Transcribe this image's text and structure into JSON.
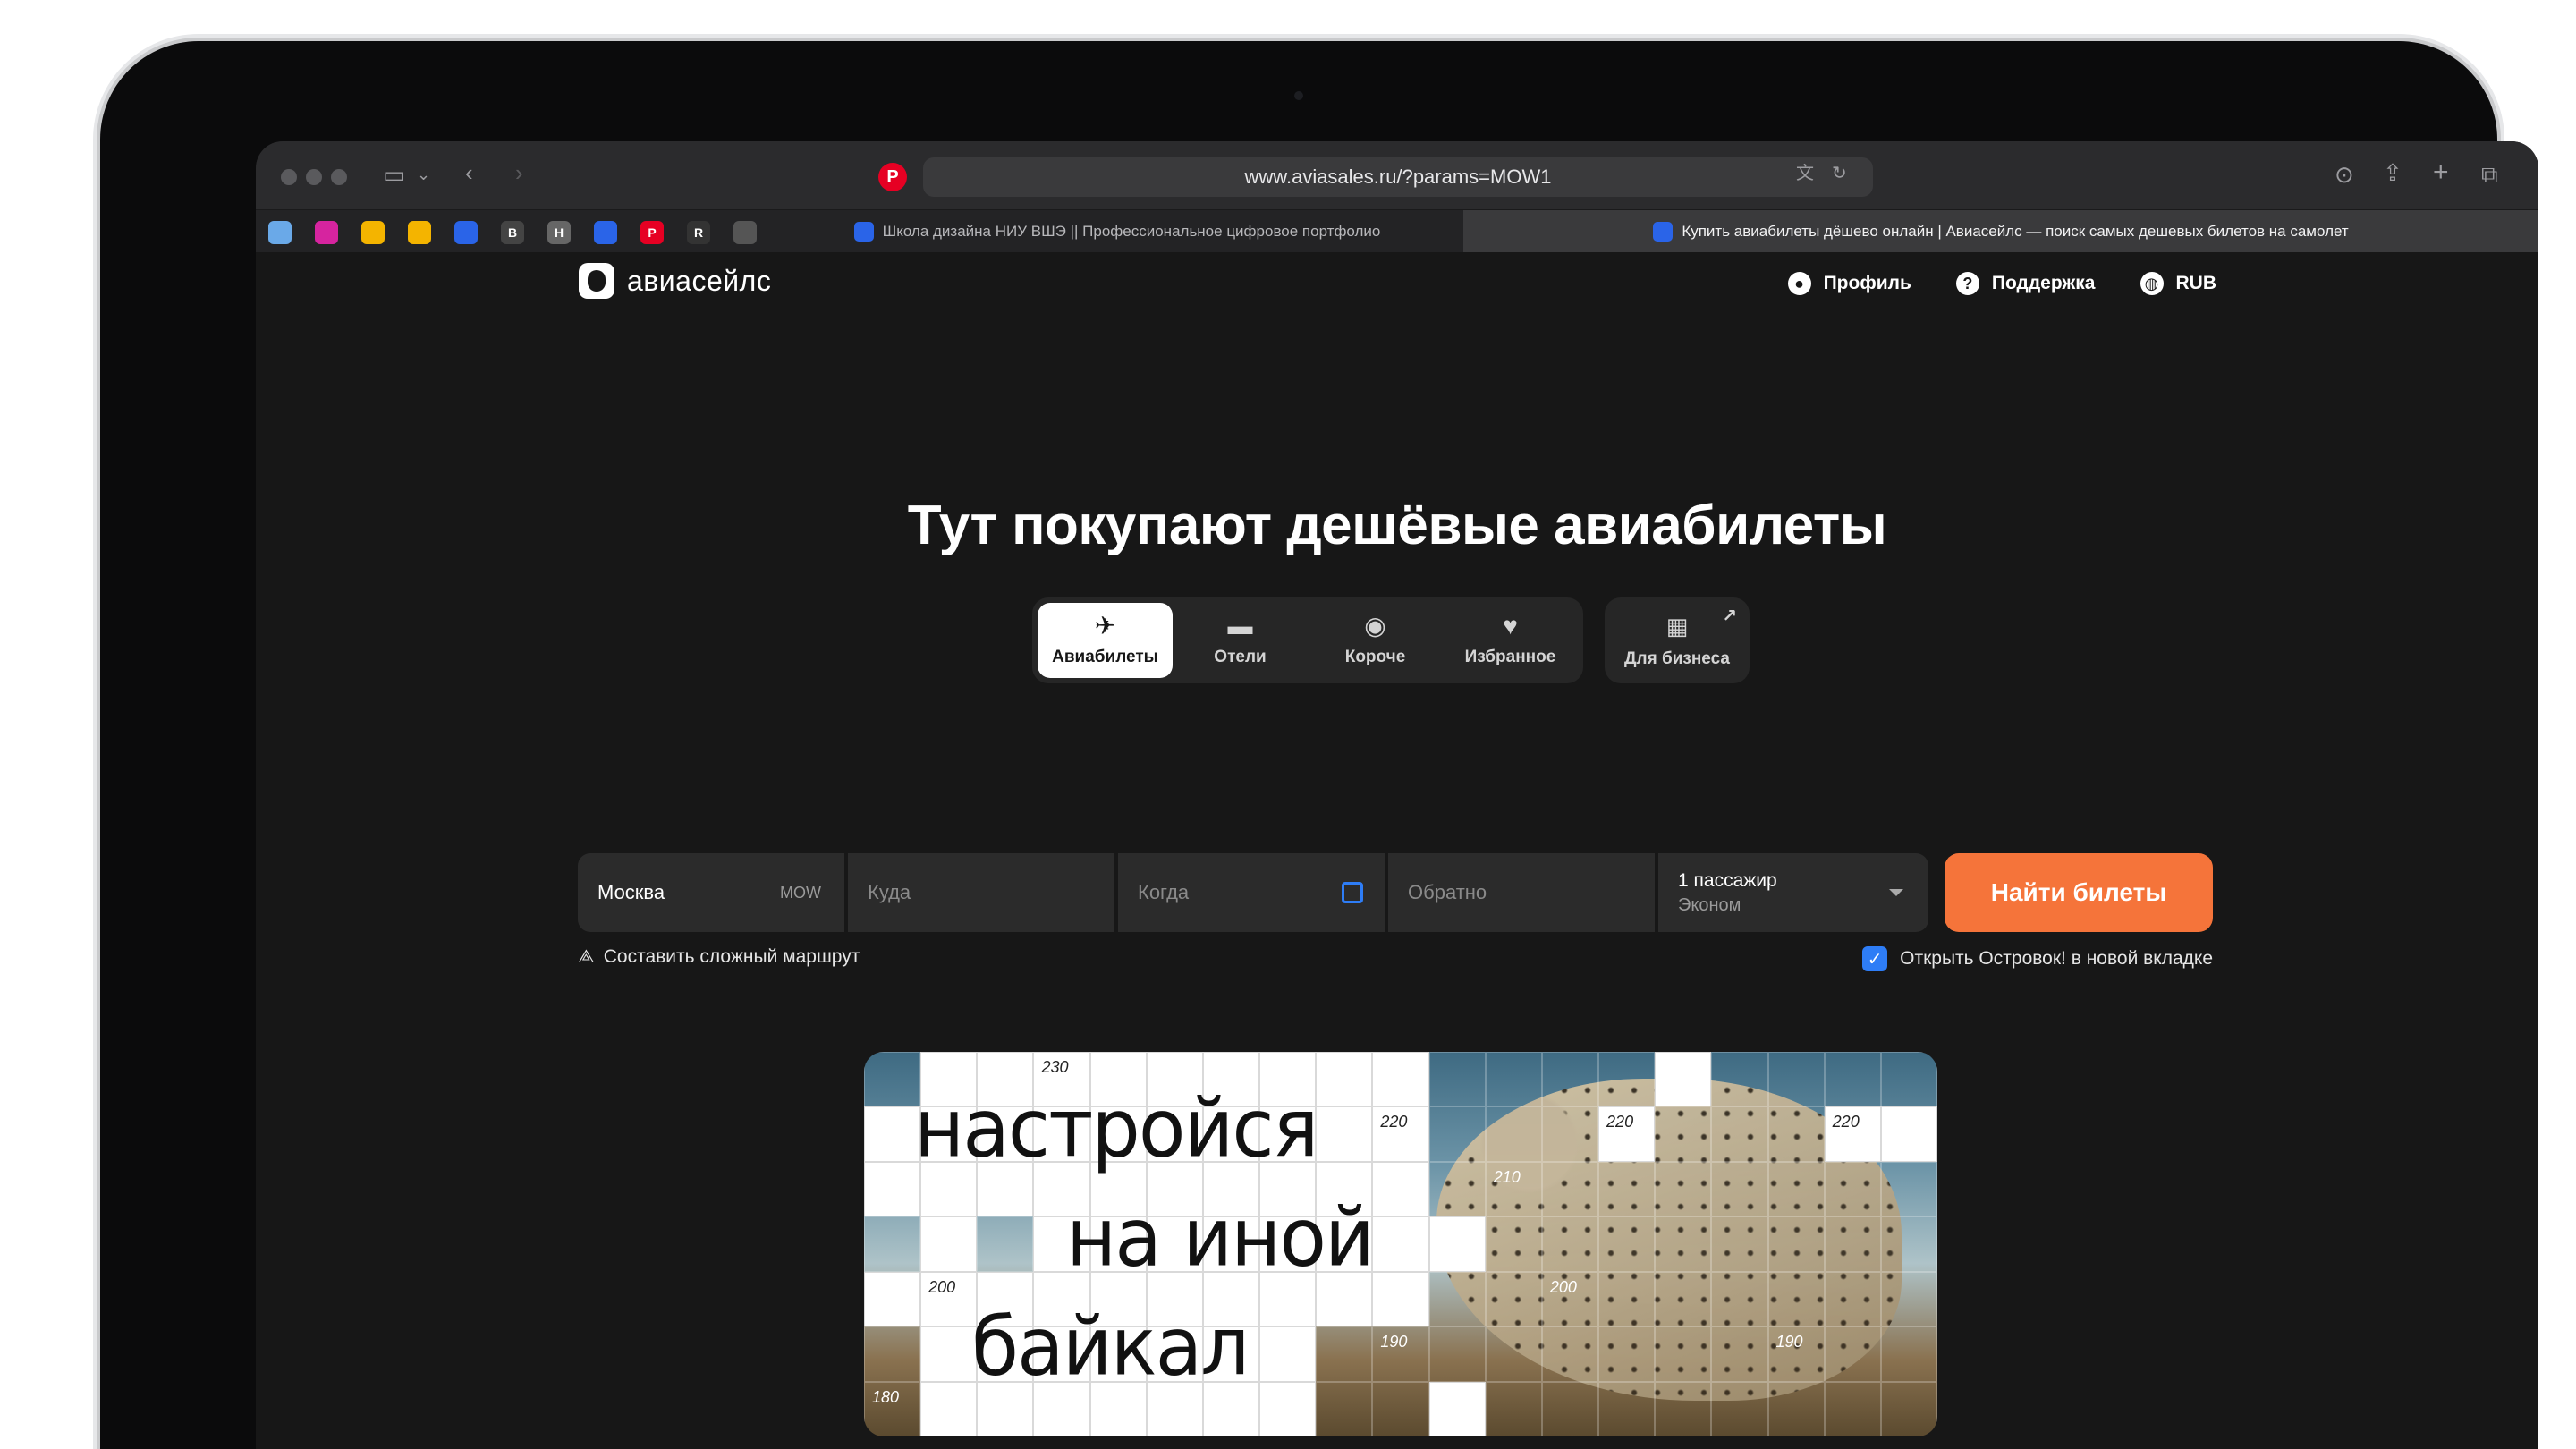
{
  "browser": {
    "url": "www.aviasales.ru/?params=MOW1",
    "tabs": [
      {
        "title": "Школа дизайна НИУ ВШЭ || Профессиональное цифровое портфолио",
        "active": false
      },
      {
        "title": "Купить авиабилеты дёшево онлайн | Авиасейлс — поиск самых дешевых билетов на самолет",
        "active": true
      }
    ]
  },
  "header": {
    "logo": "авиасейлс",
    "nav": [
      {
        "label": "Профиль",
        "icon": "user-icon"
      },
      {
        "label": "Поддержка",
        "icon": "help-icon"
      },
      {
        "label": "RUB",
        "icon": "globe-icon"
      }
    ]
  },
  "hero": {
    "title": "Тут покупают дешёвые авиабилеты"
  },
  "product_tabs": [
    {
      "label": "Авиабилеты",
      "icon": "plane-icon",
      "active": true
    },
    {
      "label": "Отели",
      "icon": "bed-icon",
      "active": false
    },
    {
      "label": "Короче",
      "icon": "pin-icon",
      "active": false
    },
    {
      "label": "Избранное",
      "icon": "heart-icon",
      "active": false
    }
  ],
  "business_tab": {
    "label": "Для бизнеса",
    "icon": "briefcase-icon"
  },
  "search": {
    "from_value": "Москва",
    "from_code": "MOW",
    "to_placeholder": "Куда",
    "when_placeholder": "Когда",
    "back_placeholder": "Обратно",
    "passengers": "1 пассажир",
    "cabin": "Эконом",
    "submit": "Найти билеты"
  },
  "options": {
    "complex_route": "Составить сложный маршрут",
    "ostrovok": "Открыть Островок! в новой вкладке",
    "ostrovok_checked": true
  },
  "banner": {
    "lines": [
      "настройся",
      "на иной",
      "байкал"
    ],
    "numbers": [
      "230",
      "220",
      "220",
      "220",
      "210",
      "200",
      "200",
      "190",
      "190",
      "180"
    ]
  }
}
